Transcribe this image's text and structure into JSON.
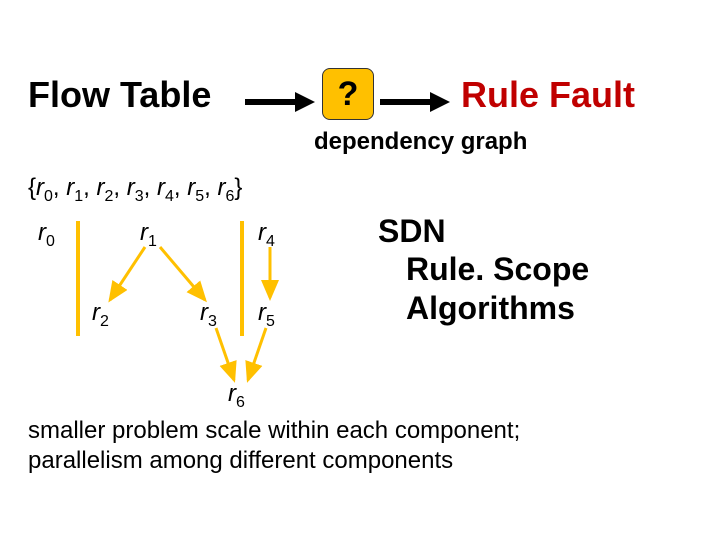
{
  "top": {
    "flow_table": "Flow Table",
    "question": "?",
    "rule_fault": "Rule Fault",
    "dep_graph": "dependency graph"
  },
  "rule_set": {
    "open": "{",
    "close": "}",
    "items": [
      "r0",
      "r1",
      "r2",
      "r3",
      "r4",
      "r5",
      "r6"
    ]
  },
  "nodes": {
    "r0": "r0",
    "r1": "r1",
    "r2": "r2",
    "r3": "r3",
    "r4": "r4",
    "r5": "r5",
    "r6": "r6"
  },
  "sdn": {
    "line1": "SDN",
    "line2": "Rule. Scope",
    "line3": "Algorithms"
  },
  "bottom": {
    "line1": "smaller problem scale within each component;",
    "line2": "parallelism among different components"
  },
  "colors": {
    "accent_yellow": "#ffc000",
    "rule_fault_red": "#c00000"
  }
}
